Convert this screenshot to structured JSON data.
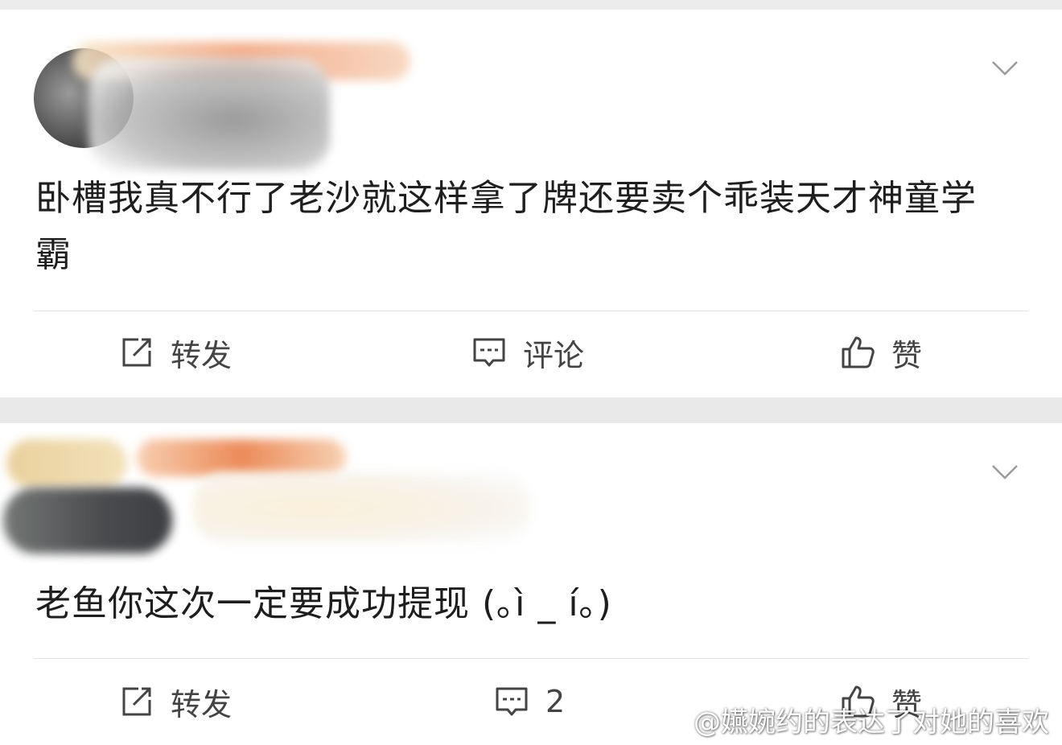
{
  "posts": [
    {
      "text": "卧槽我真不行了老沙就这样拿了牌还要卖个乖装天才神童学霸",
      "actions": {
        "repost": "转发",
        "comment": "评论",
        "like": "赞"
      }
    },
    {
      "text": "老鱼你这次一定要成功提现 (｡ì _ í｡)",
      "actions": {
        "repost": "转发",
        "comment": "2",
        "like": "赞"
      }
    }
  ],
  "watermark": {
    "text": "@嬿婉约的表达了对她的喜欢"
  },
  "icons": {
    "repost": "repost-icon",
    "comment": "comment-icon",
    "like": "thumbs-up-icon",
    "expand": "chevron-down-icon",
    "weibo": "weibo-logo-icon"
  },
  "colors": {
    "background": "#e9e9e9",
    "card": "#ffffff",
    "text": "#1e1e1e",
    "icon": "#444444"
  }
}
